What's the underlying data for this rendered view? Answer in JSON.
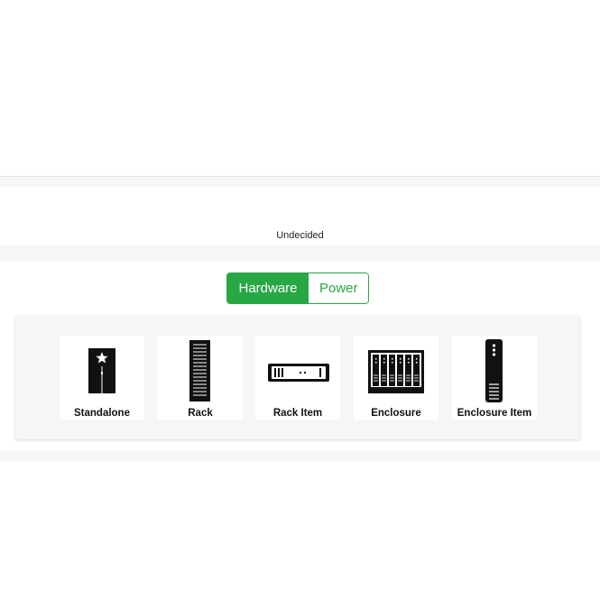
{
  "status": {
    "text": "Undecided"
  },
  "toggle": {
    "active": "Hardware",
    "inactive": "Power",
    "accent": "#28a745"
  },
  "items": [
    {
      "label": "Standalone",
      "icon": "standalone-server-icon"
    },
    {
      "label": "Rack",
      "icon": "rack-icon"
    },
    {
      "label": "Rack Item",
      "icon": "rack-item-icon"
    },
    {
      "label": "Enclosure",
      "icon": "enclosure-icon"
    },
    {
      "label": "Enclosure Item",
      "icon": "enclosure-item-icon"
    }
  ]
}
